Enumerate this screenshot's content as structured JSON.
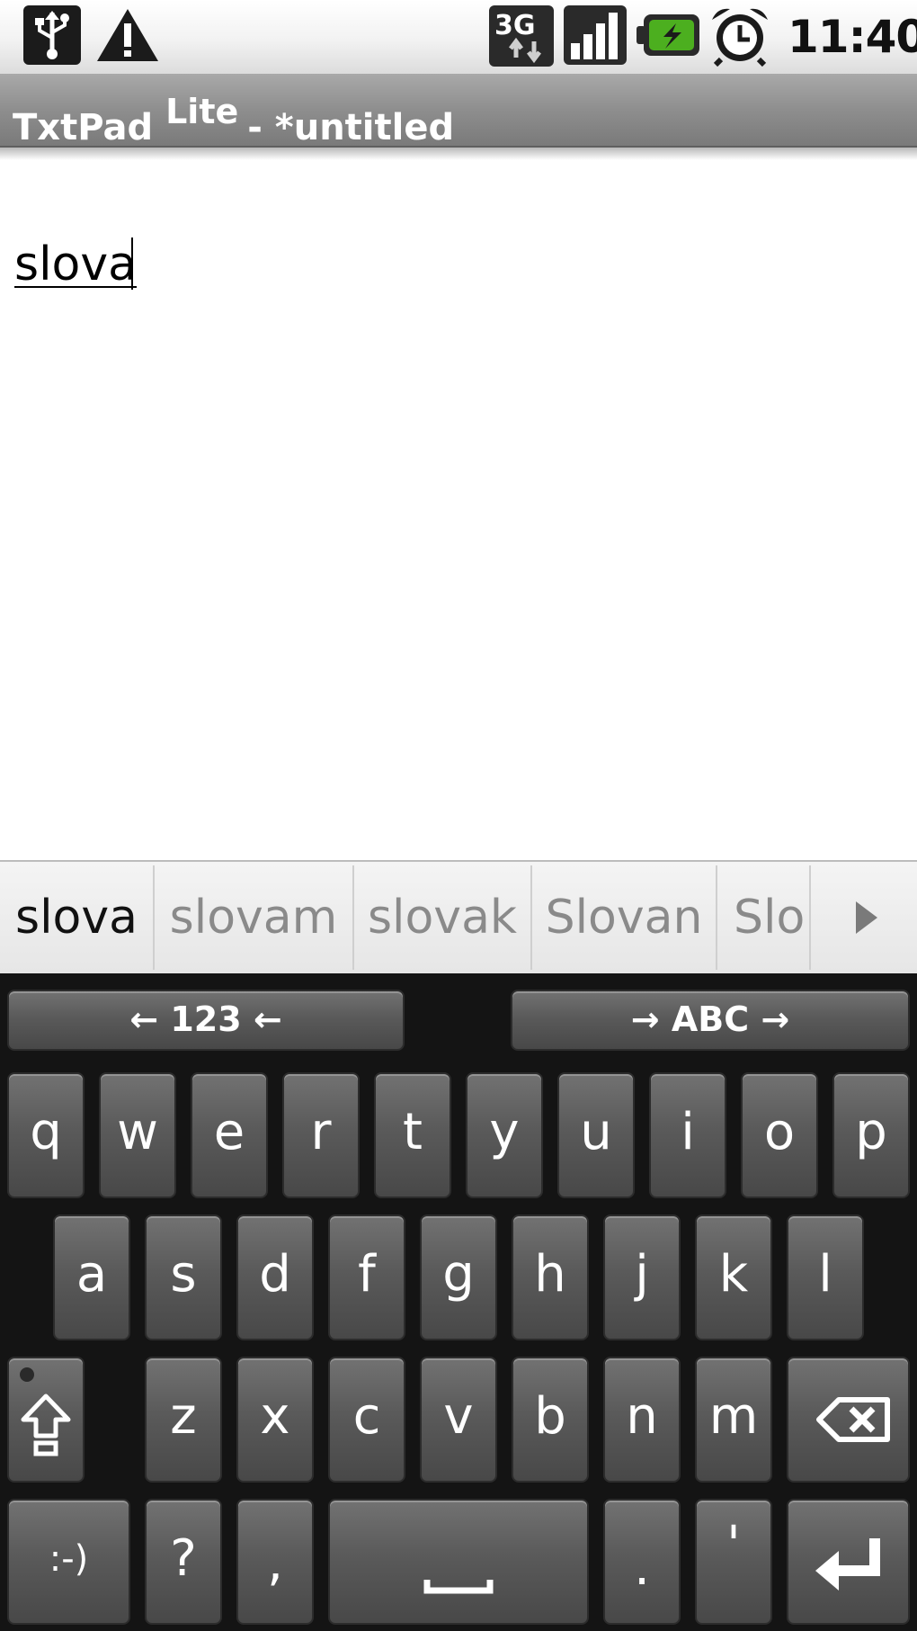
{
  "status_bar": {
    "time": "11:40",
    "icons": [
      "usb-icon",
      "warning-icon",
      "data-3g-icon",
      "signal-icon",
      "battery-charging-icon",
      "alarm-icon"
    ],
    "network_label": "3G"
  },
  "title_bar": {
    "app_name": "TxtPad",
    "edition": "Lite",
    "document": "- *untitled"
  },
  "editor": {
    "text": "slova"
  },
  "suggestions": {
    "items": [
      "slova",
      "slovam",
      "slovak",
      "Slovan",
      "Slo"
    ],
    "more_icon": "arrow-right-icon"
  },
  "keyboard": {
    "lang_left": "← 123 ←",
    "lang_right": "→ ABC →",
    "row1": [
      "q",
      "w",
      "e",
      "r",
      "t",
      "y",
      "u",
      "i",
      "o",
      "p"
    ],
    "row2": [
      "a",
      "s",
      "d",
      "f",
      "g",
      "h",
      "j",
      "k",
      "l"
    ],
    "row3": [
      "z",
      "x",
      "c",
      "v",
      "b",
      "n",
      "m"
    ],
    "row4": {
      "smiley": ":-)",
      "question": "?",
      "comma": ",",
      "period": ".",
      "apostrophe": "'"
    },
    "special_icons": [
      "shift-icon",
      "backspace-icon",
      "space-icon",
      "enter-icon"
    ]
  },
  "colors": {
    "title_bar": "#8e8e8e",
    "keyboard_bg": "#141414",
    "key_face": "#5a5a5a",
    "battery_accent": "#4caf1f"
  }
}
